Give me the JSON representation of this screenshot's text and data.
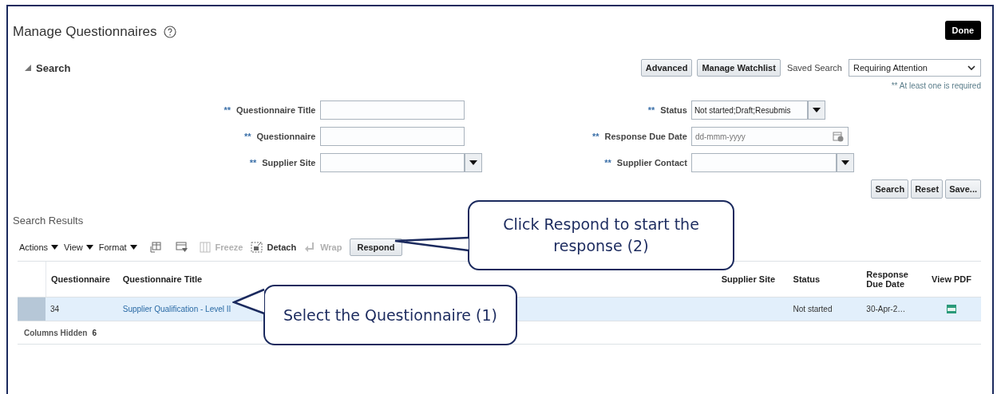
{
  "page": {
    "title": "Manage Questionnaires",
    "done_button": "Done"
  },
  "search": {
    "title": "Search",
    "expanded": true,
    "buttons": [
      "Advanced",
      "Manage Watchlist"
    ],
    "saved_search": {
      "label": "Saved Search",
      "value": "Requiring Attention"
    },
    "required_note": "** At least one is required",
    "left_fields": [
      {
        "label": "Questionnaire Title",
        "required_mark": "**",
        "kind": "text"
      },
      {
        "label": "Questionnaire",
        "required_mark": "**",
        "kind": "text"
      },
      {
        "label": "Supplier Site",
        "required_mark": "**",
        "kind": "select"
      }
    ],
    "right_fields": [
      {
        "label": "Status",
        "required_mark": "**",
        "kind": "select-short",
        "value": "Not started;Draft;Resubmis"
      },
      {
        "label": "Response Due Date",
        "required_mark": "**",
        "kind": "date",
        "placeholder": "dd-mmm-yyyy"
      },
      {
        "label": "Supplier Contact",
        "required_mark": "**",
        "kind": "select"
      }
    ],
    "actions": [
      "Search",
      "Reset",
      "Save..."
    ]
  },
  "results": {
    "title": "Search Results",
    "toolbar": [
      {
        "kind": "menu",
        "label": "Actions"
      },
      {
        "kind": "menu",
        "label": "View"
      },
      {
        "kind": "menu",
        "label": "Format"
      },
      {
        "kind": "icon",
        "disabled": false
      },
      {
        "kind": "icon",
        "disabled": false
      },
      {
        "kind": "tool",
        "label": "Freeze",
        "disabled": true
      },
      {
        "kind": "tool",
        "label": "Detach",
        "disabled": false
      },
      {
        "kind": "tool",
        "label": "Wrap",
        "disabled": true
      },
      {
        "kind": "button",
        "label": "Respond"
      }
    ],
    "columns": [
      "Questionnaire",
      "Questionnaire Title",
      "Supplier Site",
      "Status",
      "Response Due Date",
      "View PDF"
    ],
    "rows": [
      {
        "selected": true,
        "questionnaire": "34",
        "title": "Supplier Qualification - Level II",
        "status": "Not started",
        "due_date": "30-Apr-2…",
        "pdf": true
      }
    ],
    "hidden_label": "Columns Hidden",
    "hidden_count": "6"
  },
  "callouts": [
    {
      "text": "Click Respond to start the response (2)"
    },
    {
      "text": "Select the Questionnaire (1)"
    }
  ]
}
